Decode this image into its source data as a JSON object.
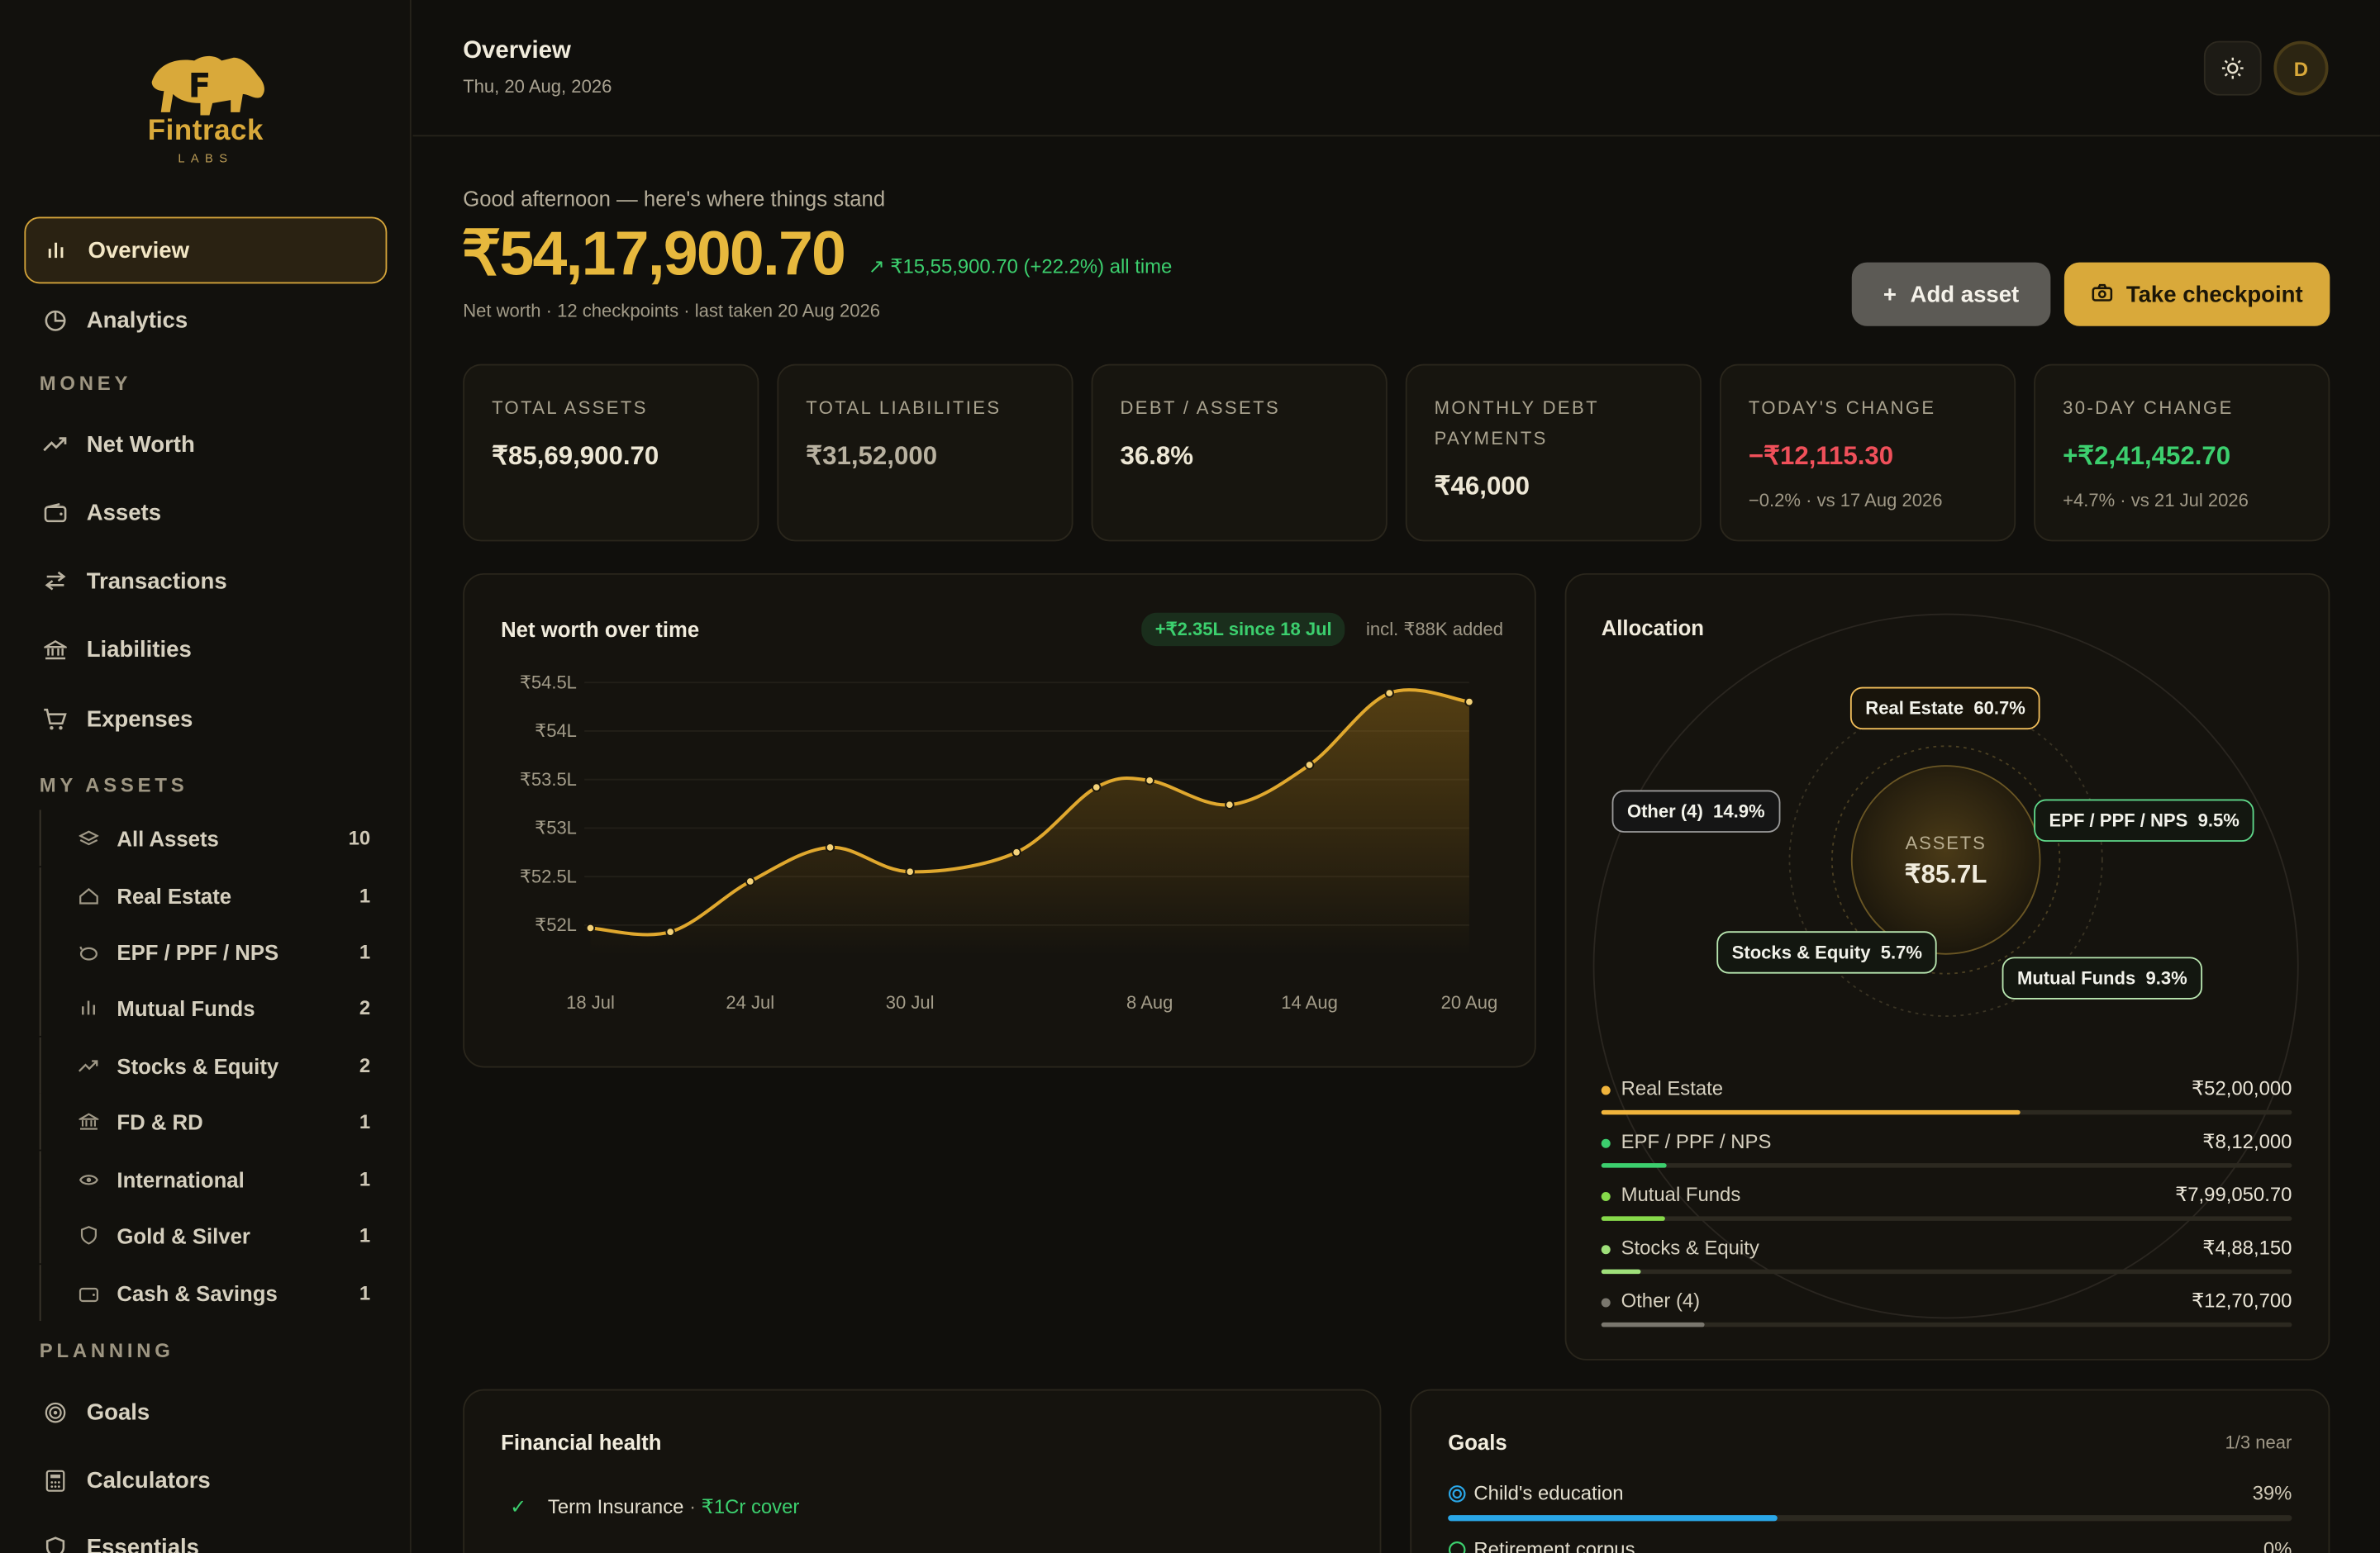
{
  "brand": {
    "name": "Fintrack",
    "sub": "LABS"
  },
  "sidebar": {
    "overview": "Overview",
    "analytics": "Analytics",
    "money_heading": "MONEY",
    "money": [
      "Net Worth",
      "Assets",
      "Transactions",
      "Liabilities",
      "Expenses"
    ],
    "assets_heading": "MY ASSETS",
    "assets": [
      {
        "label": "All Assets",
        "count": "10"
      },
      {
        "label": "Real Estate",
        "count": "1"
      },
      {
        "label": "EPF / PPF / NPS",
        "count": "1"
      },
      {
        "label": "Mutual Funds",
        "count": "2"
      },
      {
        "label": "Stocks & Equity",
        "count": "2"
      },
      {
        "label": "FD & RD",
        "count": "1"
      },
      {
        "label": "International",
        "count": "1"
      },
      {
        "label": "Gold & Silver",
        "count": "1"
      },
      {
        "label": "Cash & Savings",
        "count": "1"
      }
    ],
    "planning_heading": "PLANNING",
    "planning": [
      "Goals",
      "Calculators",
      "Essentials"
    ]
  },
  "header": {
    "title": "Overview",
    "date": "Thu, 20 Aug, 2026",
    "avatar": "D"
  },
  "hero": {
    "greeting": "Good afternoon — here's where things stand",
    "net_worth": "₹54,17,900.70",
    "gain": "₹15,55,900.70 (+22.2%) all time",
    "meta": "Net worth · 12 checkpoints · last taken 20 Aug 2026",
    "add_asset": "Add asset",
    "take_checkpoint": "Take checkpoint"
  },
  "cards": [
    {
      "label": "TOTAL ASSETS",
      "value": "₹85,69,900.70",
      "sub": "",
      "color": "#ede7d5"
    },
    {
      "label": "TOTAL LIABILITIES",
      "value": "₹31,52,000",
      "sub": "",
      "color": "#b8b1a0"
    },
    {
      "label": "DEBT / ASSETS",
      "value": "36.8%",
      "sub": "",
      "color": "#ede7d5"
    },
    {
      "label": "MONTHLY DEBT PAYMENTS",
      "value": "₹46,000",
      "sub": "",
      "color": "#ede7d5"
    },
    {
      "label": "TODAY'S CHANGE",
      "value": "−₹12,115.30",
      "sub": "−0.2% · vs 17 Aug 2026",
      "color": "#f0505a"
    },
    {
      "label": "30-DAY CHANGE",
      "value": "+₹2,41,452.70",
      "sub": "+4.7% · vs 21 Jul 2026",
      "color": "#3ccf6e"
    }
  ],
  "nw_chart": {
    "title": "Net worth over time",
    "chip": "+₹2.35L since 18 Jul",
    "note": "incl. ₹88K added"
  },
  "chart_data": {
    "type": "area",
    "title": "Net worth over time",
    "ylabel": "",
    "y_ticks": [
      "₹54.5L",
      "₹54L",
      "₹53.5L",
      "₹53L",
      "₹52.5L",
      "₹52L"
    ],
    "ylim": [
      52.0,
      54.5
    ],
    "x_ticks": [
      "18 Jul",
      "24 Jul",
      "30 Jul",
      "8 Aug",
      "14 Aug",
      "20 Aug"
    ],
    "x": [
      "18 Jul",
      "21 Jul",
      "24 Jul",
      "27 Jul",
      "30 Jul",
      "3 Aug",
      "6 Aug",
      "8 Aug",
      "11 Aug",
      "14 Aug",
      "17 Aug",
      "20 Aug"
    ],
    "values": [
      51.97,
      51.93,
      52.45,
      52.8,
      52.55,
      52.75,
      53.42,
      53.49,
      53.24,
      53.65,
      54.39,
      54.3
    ],
    "units": "₹ lakh",
    "color": "#e0a82e"
  },
  "allocation": {
    "title": "Allocation",
    "center_label": "ASSETS",
    "center_value": "₹85.7L",
    "bubbles": [
      {
        "name": "Real Estate",
        "pct": "60.7%"
      },
      {
        "name": "Other (4)",
        "pct": "14.9%"
      },
      {
        "name": "EPF / PPF / NPS",
        "pct": "9.5%"
      },
      {
        "name": "Stocks & Equity",
        "pct": "5.7%"
      },
      {
        "name": "Mutual Funds",
        "pct": "9.3%"
      }
    ],
    "rows": [
      {
        "name": "Real Estate",
        "amount": "₹52,00,000",
        "share": 0.607,
        "color": "#f0b43c"
      },
      {
        "name": "EPF / PPF / NPS",
        "amount": "₹8,12,000",
        "share": 0.095,
        "color": "#3ccf6e"
      },
      {
        "name": "Mutual Funds",
        "amount": "₹7,99,050.70",
        "share": 0.093,
        "color": "#86d94a"
      },
      {
        "name": "Stocks & Equity",
        "amount": "₹4,88,150",
        "share": 0.057,
        "color": "#9fe07a"
      },
      {
        "name": "Other (4)",
        "amount": "₹12,70,700",
        "share": 0.149,
        "color": "#7a776e"
      }
    ]
  },
  "health": {
    "title": "Financial health",
    "item": "Term Insurance",
    "item_sep": " · ",
    "item_note": "₹1Cr cover"
  },
  "goals": {
    "title": "Goals",
    "summary": "1/3 near",
    "items": [
      {
        "name": "Child's education",
        "pct": "39%",
        "progress": 0.39,
        "color": "#2aa7e8"
      },
      {
        "name": "Retirement corpus",
        "pct": "0%",
        "progress": 0.0,
        "color": "#3ccf6e"
      }
    ]
  }
}
